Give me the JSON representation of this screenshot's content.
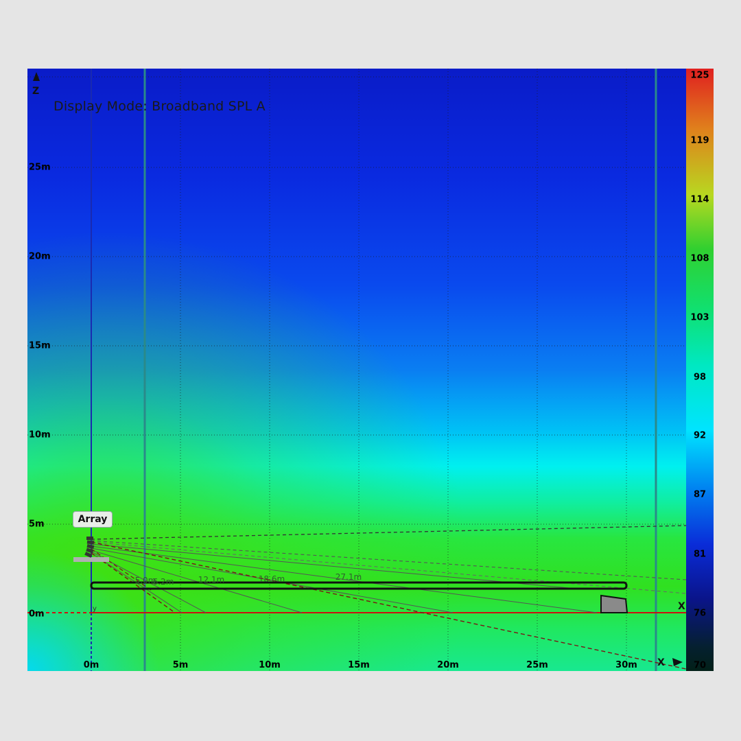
{
  "display_mode": "Display Mode: Broadband SPL A",
  "axis": {
    "z_letter": "Z",
    "x_letter": "X",
    "z_ticks": [
      "25m",
      "20m",
      "15m",
      "10m",
      "5m",
      "0m"
    ],
    "x_ticks": [
      "0m",
      "5m",
      "10m",
      "15m",
      "20m",
      "25m",
      "30m"
    ]
  },
  "array_label": "Array",
  "distance_labels": [
    "5.0m",
    "6.2m",
    "12.1m",
    "18.6m",
    "27.1m"
  ],
  "color_scale": {
    "labels": [
      "125",
      "119",
      "114",
      "108",
      "103",
      "98",
      "92",
      "87",
      "81",
      "76",
      "70"
    ]
  }
}
